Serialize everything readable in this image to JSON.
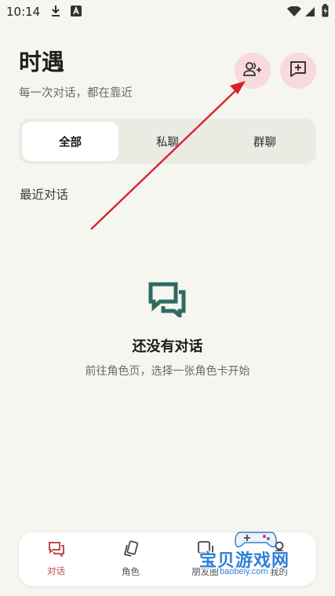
{
  "status_bar": {
    "time": "10:14",
    "left_icons": [
      "download-icon",
      "a-badge-icon"
    ],
    "right_icons": [
      "wifi-icon",
      "signal-icon",
      "battery-icon"
    ]
  },
  "header": {
    "title": "时遇",
    "subtitle": "每一次对话，都在靠近",
    "actions": [
      "add-contact-icon",
      "new-chat-icon"
    ]
  },
  "tabs": [
    {
      "label": "全部",
      "active": true
    },
    {
      "label": "私聊",
      "active": false
    },
    {
      "label": "群聊",
      "active": false
    }
  ],
  "section": {
    "title": "最近对话"
  },
  "empty_state": {
    "icon": "chat-bubbles-icon",
    "title": "还没有对话",
    "description": "前往角色页，选择一张角色卡开始"
  },
  "bottom_nav": [
    {
      "label": "对话",
      "icon": "chat-icon",
      "active": true
    },
    {
      "label": "角色",
      "icon": "cards-icon",
      "active": false
    },
    {
      "label": "朋友圈",
      "icon": "moments-icon",
      "active": false
    },
    {
      "label": "我的",
      "icon": "profile-icon",
      "active": false
    }
  ],
  "colors": {
    "background": "#f6f6f1",
    "accent": "#c44a56",
    "action_button_bg": "#f9d9dc",
    "empty_icon": "#2f6b60",
    "annotation_arrow": "#d8232a"
  },
  "watermark": {
    "text": "宝贝游戏网",
    "url": "baobeiy.com"
  }
}
